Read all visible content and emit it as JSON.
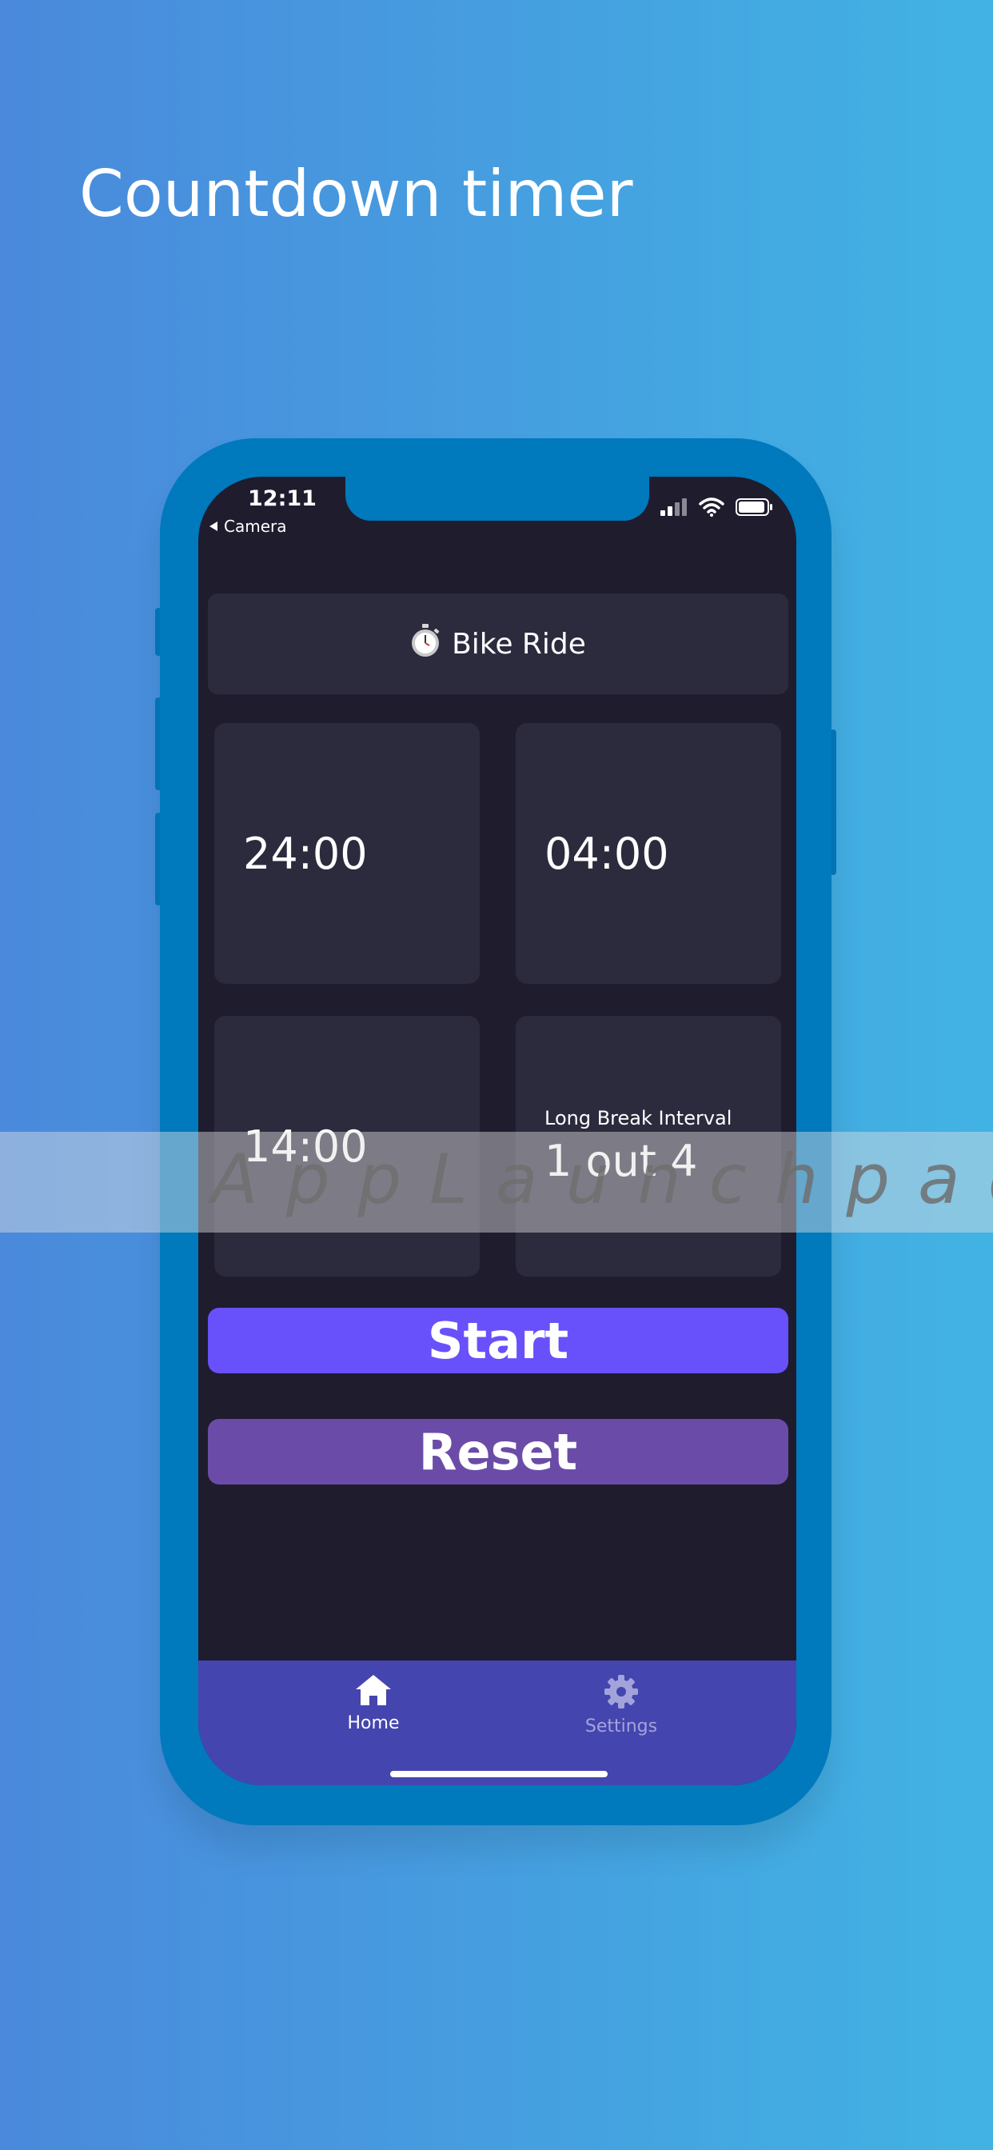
{
  "headline": "Countdown timer",
  "status_bar": {
    "time": "12:11",
    "back_label": "Camera"
  },
  "timer": {
    "emoji": "⏱️",
    "title": "Bike Ride"
  },
  "tiles": [
    {
      "value": "24:00"
    },
    {
      "value": "04:00"
    },
    {
      "value": "14:00"
    },
    {
      "label": "Long Break Interval",
      "value": "1 out 4"
    }
  ],
  "buttons": {
    "start": "Start",
    "reset": "Reset"
  },
  "tabs": [
    {
      "label": "Home",
      "icon": "home-icon",
      "active": true
    },
    {
      "label": "Settings",
      "icon": "gear-icon",
      "active": false
    }
  ],
  "watermark": "AppLaunchpad",
  "colors": {
    "background_start": "#4a89dc",
    "background_end": "#41b3e3",
    "phone_frame": "#0079bd",
    "screen": "#1f1c2e",
    "card": "#2c2a3d",
    "start_button": "#6850fb",
    "reset_button": "#6a4ca8",
    "tab_bar": "#4545b0"
  }
}
